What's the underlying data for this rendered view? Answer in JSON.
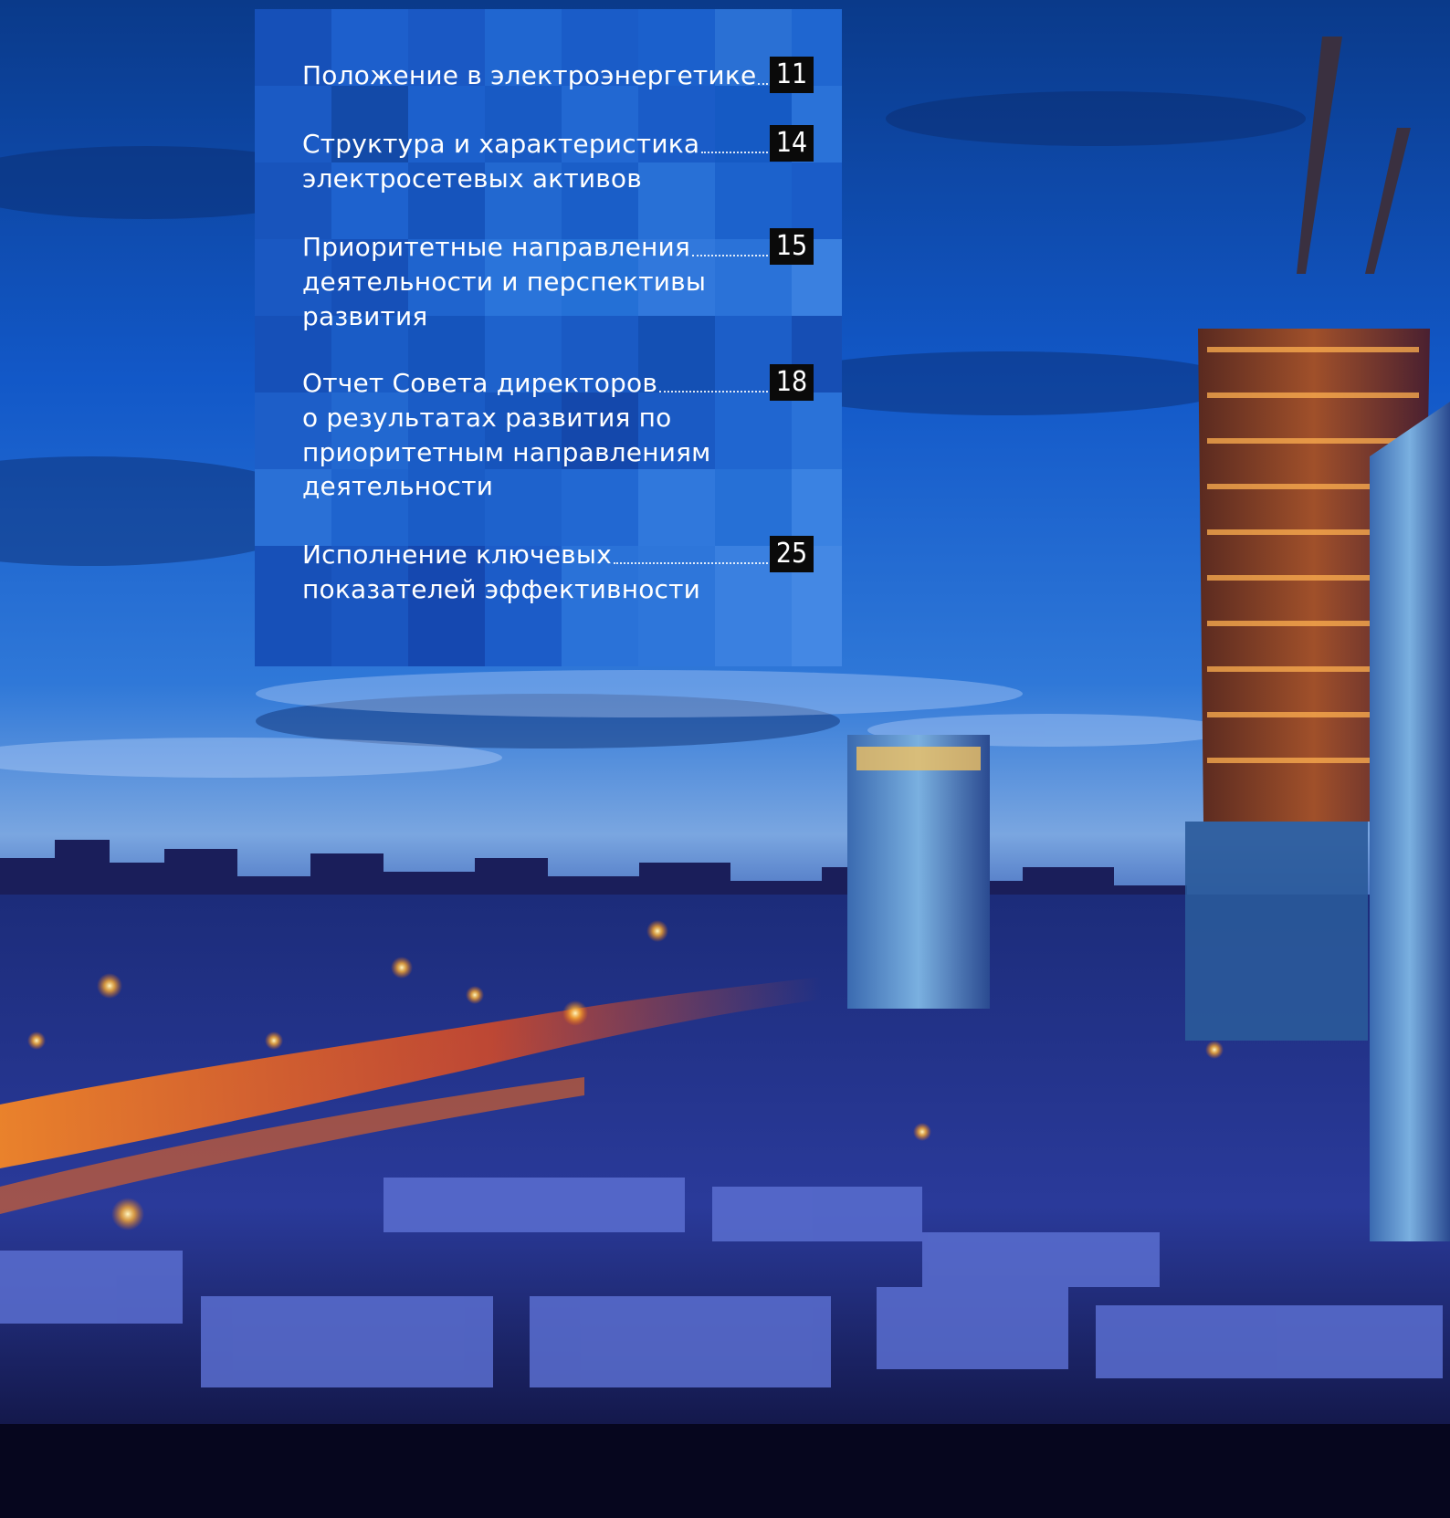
{
  "toc": {
    "items": [
      {
        "lines": [
          "Положение в электроэнергетике"
        ],
        "page": "11"
      },
      {
        "lines": [
          "Структура и характеристика",
          "электросетевых активов"
        ],
        "page": "14"
      },
      {
        "lines": [
          "Приоритетные направления",
          "деятельности и перспективы",
          "развития"
        ],
        "page": "15"
      },
      {
        "lines": [
          "Отчет Совета директоров",
          "о результатах развития по",
          "приоритетным направлениям",
          "деятельности"
        ],
        "page": "18"
      },
      {
        "lines": [
          "Исполнение ключевых",
          "показателей эффективности"
        ],
        "page": "25"
      }
    ]
  },
  "colors": {
    "panel_base": "#1a5cc7",
    "page_box": "#0a0a0a",
    "text": "#ffffff"
  }
}
